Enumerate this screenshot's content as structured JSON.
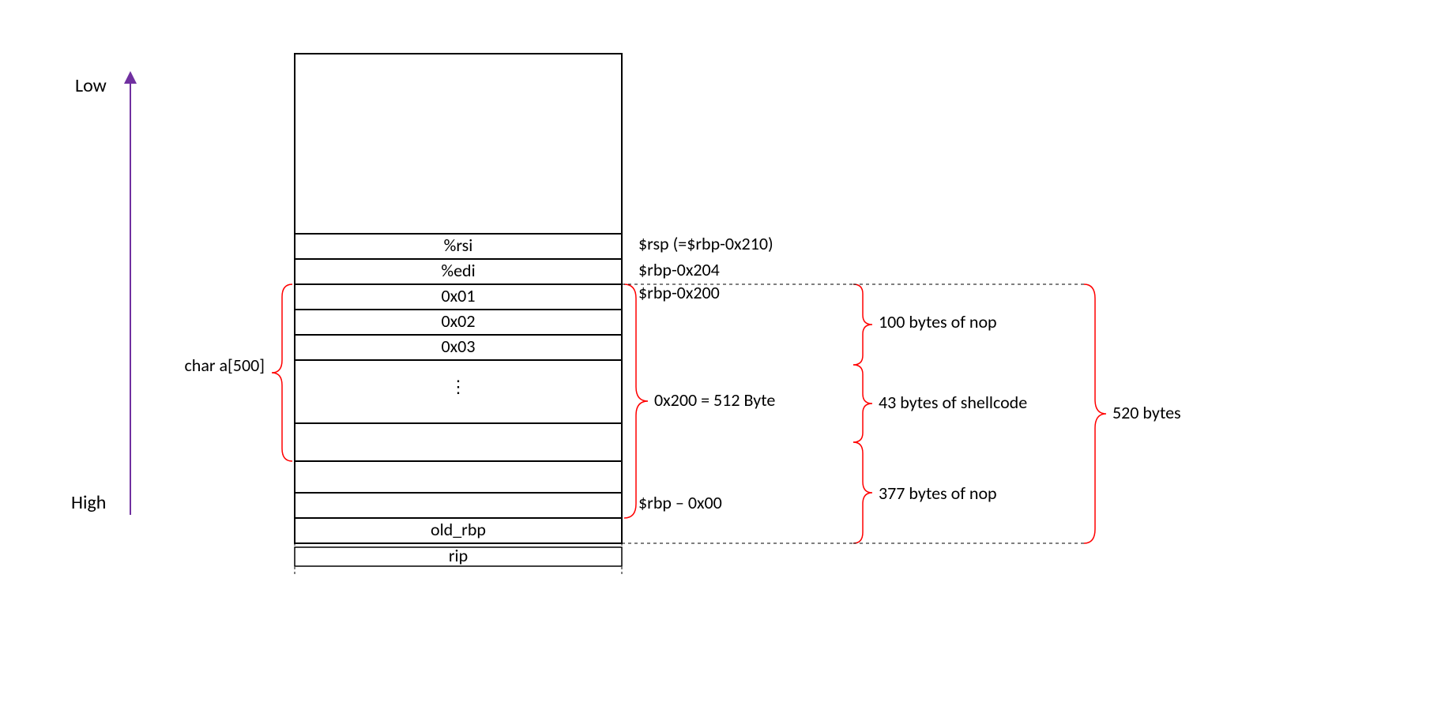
{
  "labels": {
    "low": "Low",
    "high": "High",
    "rsi": "%rsi",
    "edi": "%edi",
    "c0x01": "0x01",
    "c0x02": "0x02",
    "c0x03": "0x03",
    "old_rbp": "old_rbp",
    "rip": "rip",
    "rsp_note": "$rsp (=$rbp-0x210)",
    "rbp_204": "$rbp-0x204",
    "rbp_200": "$rbp-0x200",
    "rbp_0": "$rbp – 0x00",
    "char_a": "char a[500]",
    "byte_eq": "0x200 = 512 Byte",
    "nop100": "100 bytes of nop",
    "shell43": "43 bytes of shellcode",
    "nop377": "377 bytes of nop",
    "b520": "520 bytes",
    "vdots": "⋮"
  }
}
